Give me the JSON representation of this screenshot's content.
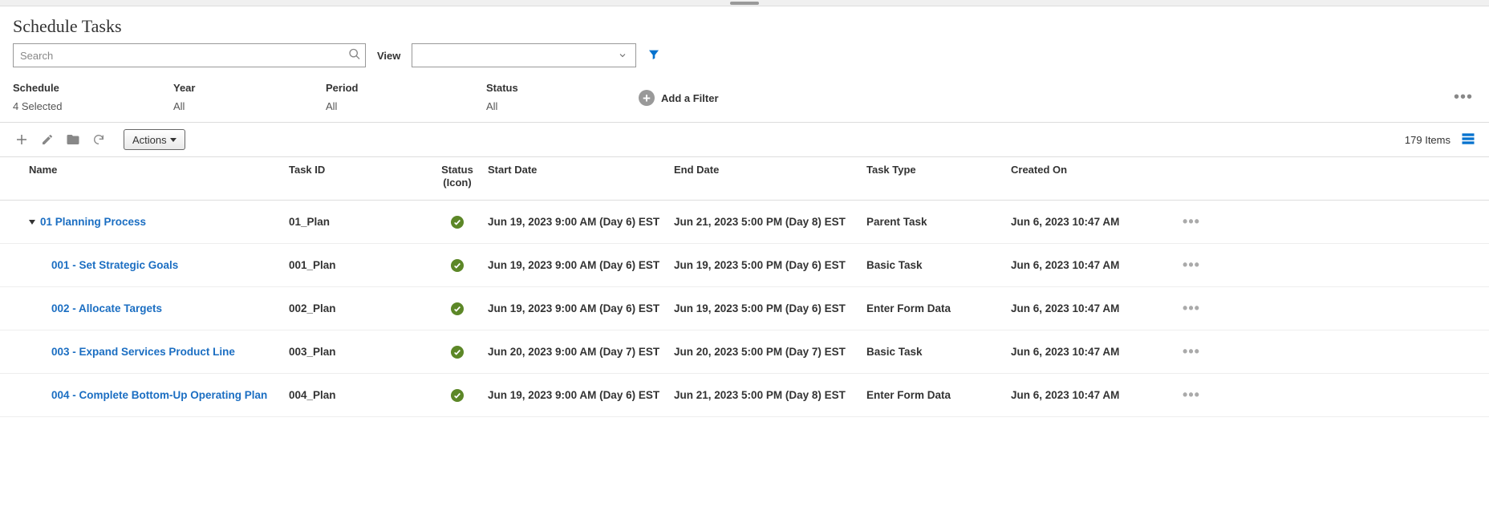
{
  "page_title": "Schedule Tasks",
  "search": {
    "placeholder": "Search"
  },
  "view": {
    "label": "View"
  },
  "filters": {
    "schedule": {
      "label": "Schedule",
      "value": "4 Selected"
    },
    "year": {
      "label": "Year",
      "value": "All"
    },
    "period": {
      "label": "Period",
      "value": "All"
    },
    "status": {
      "label": "Status",
      "value": "All"
    },
    "add_filter": "Add a Filter"
  },
  "toolbar": {
    "actions_label": "Actions",
    "item_count": "179 Items"
  },
  "columns": {
    "name": "Name",
    "task_id": "Task ID",
    "status_line1": "Status",
    "status_line2": "(Icon)",
    "start_date": "Start Date",
    "end_date": "End Date",
    "task_type": "Task Type",
    "created_on": "Created On"
  },
  "rows": [
    {
      "level": 0,
      "expanded": true,
      "name": "01 Planning Process",
      "task_id": "01_Plan",
      "status": "ok",
      "start_date": "Jun 19, 2023 9:00 AM (Day 6) EST",
      "end_date": "Jun 21, 2023 5:00 PM (Day 8) EST",
      "task_type": "Parent Task",
      "created_on": "Jun 6, 2023 10:47 AM"
    },
    {
      "level": 1,
      "name": "001 - Set Strategic Goals",
      "task_id": "001_Plan",
      "status": "ok",
      "start_date": "Jun 19, 2023 9:00 AM (Day 6) EST",
      "end_date": "Jun 19, 2023 5:00 PM (Day 6) EST",
      "task_type": "Basic Task",
      "created_on": "Jun 6, 2023 10:47 AM"
    },
    {
      "level": 1,
      "name": "002 - Allocate Targets",
      "task_id": "002_Plan",
      "status": "ok",
      "start_date": "Jun 19, 2023 9:00 AM (Day 6) EST",
      "end_date": "Jun 19, 2023 5:00 PM (Day 6) EST",
      "task_type": "Enter Form Data",
      "created_on": "Jun 6, 2023 10:47 AM"
    },
    {
      "level": 1,
      "name": "003 - Expand Services Product Line",
      "task_id": "003_Plan",
      "status": "ok",
      "start_date": "Jun 20, 2023 9:00 AM (Day 7) EST",
      "end_date": "Jun 20, 2023 5:00 PM (Day 7) EST",
      "task_type": "Basic Task",
      "created_on": "Jun 6, 2023 10:47 AM"
    },
    {
      "level": 1,
      "name": "004 - Complete Bottom-Up Operating Plan",
      "task_id": "004_Plan",
      "status": "ok",
      "start_date": "Jun 19, 2023 9:00 AM (Day 6) EST",
      "end_date": "Jun 21, 2023 5:00 PM (Day 8) EST",
      "task_type": "Enter Form Data",
      "created_on": "Jun 6, 2023 10:47 AM"
    }
  ]
}
